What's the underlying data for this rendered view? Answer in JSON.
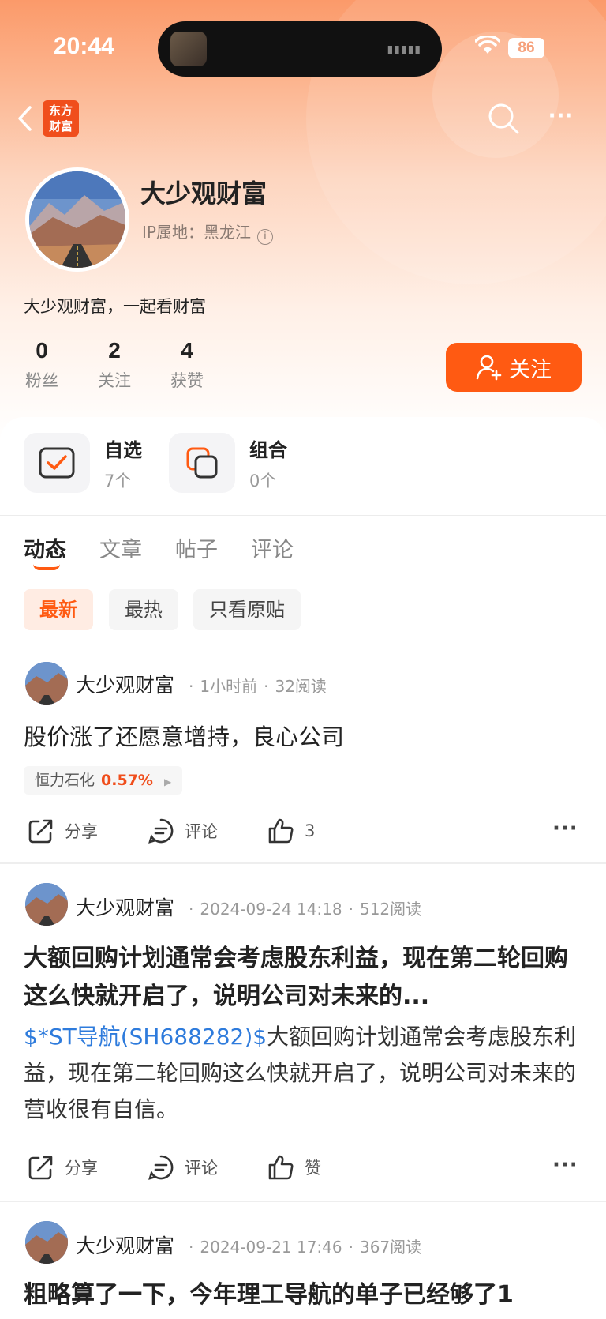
{
  "status_bar": {
    "time": "20:44",
    "battery": "86"
  },
  "header": {
    "logo_text": "东方\n财富"
  },
  "profile": {
    "name": "大少观财富",
    "ip_label": "IP属地：黑龙江",
    "bio": "大少观财富，一起看财富",
    "stats": [
      {
        "value": "0",
        "label": "粉丝"
      },
      {
        "value": "2",
        "label": "关注"
      },
      {
        "value": "4",
        "label": "获赞"
      }
    ],
    "follow_label": "关注"
  },
  "shortcuts": [
    {
      "title": "自选",
      "sub": "7个"
    },
    {
      "title": "组合",
      "sub": "0个"
    }
  ],
  "tabs": [
    "动态",
    "文章",
    "帖子",
    "评论"
  ],
  "filters": [
    "最新",
    "最热",
    "只看原贴"
  ],
  "posts": [
    {
      "author": "大少观财富",
      "time": "1小时前",
      "reads": "32阅读",
      "text": "股价涨了还愿意增持，良心公司",
      "stock_name": "恒力石化",
      "stock_pct": "0.57%",
      "share": "分享",
      "comment": "评论",
      "like": "3"
    },
    {
      "author": "大少观财富",
      "time": "2024-09-24 14:18",
      "reads": "512阅读",
      "title": "大额回购计划通常会考虑股东利益，现在第二轮回购这么快就开启了，说明公司对未来的...",
      "stock_link": "$*ST导航(SH688282)$",
      "body": "大额回购计划通常会考虑股东利益，现在第二轮回购这么快就开启了，说明公司对未来的营收很有自信。",
      "share": "分享",
      "comment": "评论",
      "like": "赞"
    },
    {
      "author": "大少观财富",
      "time": "2024-09-21 17:46",
      "reads": "367阅读",
      "title": "粗略算了一下，今年理工导航的单子已经够了1"
    }
  ]
}
